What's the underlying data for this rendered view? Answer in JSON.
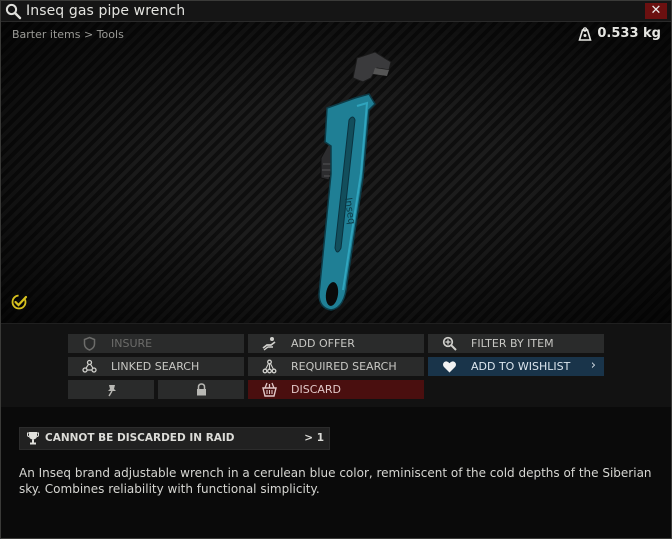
{
  "window": {
    "title": "Inseq gas pipe wrench",
    "close_label": "✕"
  },
  "image_panel": {
    "breadcrumb": "Barter items > Tools",
    "weight": "0.533 kg",
    "wrench_color": "#1f7f95"
  },
  "actions": {
    "insure": "INSURE",
    "add_offer": "ADD OFFER",
    "filter_by_item": "FILTER BY ITEM",
    "linked_search": "LINKED SEARCH",
    "required_search": "REQUIRED SEARCH",
    "add_to_wishlist": "ADD TO WISHLIST",
    "add_to_wishlist_arrow": "›",
    "discard": "DISCARD"
  },
  "restriction": {
    "label": "CANNOT BE DISCARDED IN RAID",
    "count": "> 1"
  },
  "description": "An Inseq brand adjustable wrench in a cerulean blue color, reminiscent of the cold depths of the Siberian sky. Combines reliability with functional simplicity.",
  "colors": {
    "discard_bg": "#4a0f0f",
    "wishlist_bg": "#19344a",
    "examined_icon": "#d8c21f"
  }
}
